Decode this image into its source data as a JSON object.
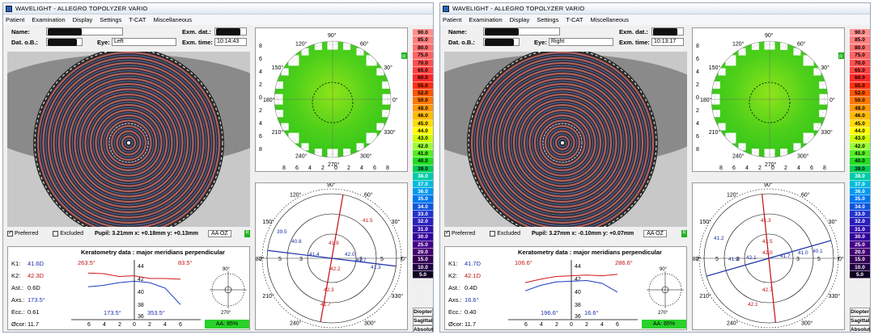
{
  "windows": [
    {
      "title": "WAVELIGHT  -  ALLEGRO TOPOLYZER VARIO",
      "menu": [
        "Patient",
        "Examination",
        "Display",
        "Settings",
        "T-CAT",
        "Miscellaneous"
      ],
      "patient": {
        "name_label": "Name:",
        "dob_label": "Dat. o.B.:",
        "eye_label": "Eye:",
        "eye_value": "Left",
        "exam_date_label": "Exm. dat.:",
        "exam_time_label": "Exm. time:",
        "exam_time_value": "10:14:43"
      },
      "eye_options": {
        "preferred": "Preferred",
        "excluded": "Excluded",
        "pupil": "Pupil: 3.21mm x: +0.18mm y: +0.13mm",
        "aa_button": "AA OZ",
        "tag": "R"
      },
      "keratometry": {
        "title": "Keratometry data : major meridians perpendicular",
        "k1_label": "K1:",
        "k1": "41.6D",
        "k2_label": "K2:",
        "k2": "42.3D",
        "ast_label": "Ast.:",
        "ast": "0.6D",
        "axs_label": "Axs.:",
        "axs": "173.5°",
        "ecc_label": "Ecc.:",
        "ecc": "0.61",
        "ocor_label": "Øcor:",
        "ocor": "11.7",
        "angle_left_top": "263.5°",
        "angle_right_top": "83.5°",
        "angle_left_bottom": "173.5°",
        "angle_right_bottom": "353.5°",
        "y_ticks": [
          "44",
          "42",
          "40",
          "38",
          "36"
        ],
        "x_ticks": [
          "6",
          "4",
          "2",
          "0",
          "2",
          "4",
          "6"
        ],
        "aa_status": "AA: 85%"
      },
      "keratometry_plot": {
        "x": [
          -6,
          -4,
          -2,
          0,
          2,
          4,
          6
        ],
        "red": [
          42.8,
          42.7,
          42.3,
          42.4,
          42.0,
          42.0,
          41.9
        ],
        "blue": [
          40.8,
          41.0,
          41.4,
          41.6,
          41.4,
          40.6,
          38.2
        ],
        "compass_top": "90°",
        "compass_bottom": "270°"
      },
      "axial_map": {
        "angles": [
          "90°",
          "60°",
          "30°",
          "0°",
          "330°",
          "300°",
          "270°",
          "240°",
          "210°",
          "180°",
          "150°",
          "120°"
        ],
        "y_ticks": [
          "8",
          "6",
          "4",
          "2",
          "0",
          "2",
          "4",
          "6",
          "8"
        ],
        "x_ticks": [
          "8",
          "6",
          "4",
          "2",
          "0",
          "2",
          "4",
          "6",
          "8"
        ],
        "tag": "R"
      },
      "meridian_map": {
        "angles": [
          "90°",
          "60°",
          "30°",
          "0°",
          "330°",
          "300°",
          "270°",
          "240°",
          "210°",
          "180°",
          "150°",
          "120°"
        ],
        "radius_labels": [
          "7",
          "5",
          "3",
          "3",
          "5",
          "7"
        ],
        "values": [
          "41.5",
          "41.9",
          "42.2",
          "42.3",
          "41.7",
          "39.5",
          "40.8",
          "41.4",
          "42.0",
          "41.7",
          "41.3"
        ]
      }
    },
    {
      "title": "WAVELIGHT  -  ALLEGRO TOPOLYZER VARIO",
      "menu": [
        "Patient",
        "Examination",
        "Display",
        "Settings",
        "T-CAT",
        "Miscellaneous"
      ],
      "patient": {
        "name_label": "Name:",
        "dob_label": "Dat. o.B.:",
        "eye_label": "Eye:",
        "eye_value": "Right",
        "exam_date_label": "Exm. dat.:",
        "exam_time_label": "Exm. time:",
        "exam_time_value": "10:13:17"
      },
      "eye_options": {
        "preferred": "Preferred",
        "excluded": "Excluded",
        "pupil": "Pupil: 3.27mm x: -0.10mm y: +0.07mm",
        "aa_button": "AA OZ",
        "tag": "R"
      },
      "keratometry": {
        "title": "Keratometry data : major meridians perpendicular",
        "k1_label": "K1:",
        "k1": "41.7D",
        "k2_label": "K2:",
        "k2": "42.1D",
        "ast_label": "Ast.:",
        "ast": "0.4D",
        "axs_label": "Axs.:",
        "axs": "16.6°",
        "ecc_label": "Ecc.:",
        "ecc": "0.40",
        "ocor_label": "Øcor:",
        "ocor": "11.7",
        "angle_left_top": "106.6°",
        "angle_right_top": "286.6°",
        "angle_left_bottom": "196.6°",
        "angle_right_bottom": "16.6°",
        "y_ticks": [
          "44",
          "42",
          "40",
          "38",
          "36"
        ],
        "x_ticks": [
          "6",
          "4",
          "2",
          "0",
          "2",
          "4",
          "6"
        ],
        "aa_status": "AA: 85%"
      },
      "keratometry_plot": {
        "x": [
          -6,
          -4,
          -2,
          0,
          2,
          4,
          6
        ],
        "red": [
          41.4,
          41.9,
          42.3,
          42.4,
          42.5,
          42.4,
          42.6
        ],
        "blue": [
          40.2,
          41.0,
          41.5,
          41.6,
          41.7,
          41.3,
          40.0
        ],
        "compass_top": "90°",
        "compass_bottom": "270°"
      },
      "axial_map": {
        "angles": [
          "90°",
          "60°",
          "30°",
          "0°",
          "330°",
          "300°",
          "270°",
          "240°",
          "210°",
          "180°",
          "150°",
          "120°"
        ],
        "y_ticks": [
          "8",
          "6",
          "4",
          "2",
          "0",
          "2",
          "4",
          "6",
          "8"
        ],
        "x_ticks": [
          "8",
          "6",
          "4",
          "2",
          "0",
          "2",
          "4",
          "6",
          "8"
        ],
        "tag": "R"
      },
      "meridian_map": {
        "angles": [
          "90°",
          "60°",
          "30°",
          "0°",
          "330°",
          "300°",
          "270°",
          "240°",
          "210°",
          "180°",
          "150°",
          "120°"
        ],
        "radius_labels": [
          "7",
          "5",
          "3",
          "3",
          "5",
          "7"
        ],
        "values": [
          "41.3",
          "41.5",
          "42.0",
          "42.7",
          "42.1",
          "41.2",
          "41.9",
          "42.1",
          "41.7",
          "41.0",
          "40.1"
        ]
      }
    }
  ],
  "scale": {
    "values": [
      "90.0",
      "85.0",
      "80.0",
      "75.0",
      "70.0",
      "65.0",
      "60.0",
      "55.0",
      "52.0",
      "50.0",
      "48.0",
      "46.0",
      "45.0",
      "44.0",
      "43.0",
      "42.0",
      "41.0",
      "40.0",
      "39.0",
      "38.0",
      "37.0",
      "36.0",
      "35.0",
      "34.0",
      "33.0",
      "32.0",
      "31.0",
      "30.0",
      "25.0",
      "20.0",
      "15.0",
      "10.0",
      "5.0"
    ],
    "colors": [
      "#ff9090",
      "#ff8080",
      "#ff7070",
      "#ff6464",
      "#ff5050",
      "#ff4040",
      "#ff2a2a",
      "#ff3010",
      "#ff5500",
      "#ff7700",
      "#ff9900",
      "#ffbb00",
      "#ffdd00",
      "#ffff00",
      "#ccff00",
      "#99ff33",
      "#55ee22",
      "#22dd22",
      "#00cc55",
      "#00ccaa",
      "#00bbdd",
      "#0099ee",
      "#0077ee",
      "#1155dd",
      "#2233cc",
      "#2a1fbb",
      "#3311aa",
      "#330099",
      "#440088",
      "#440070",
      "#330055",
      "#220044",
      "#110022"
    ],
    "footer": [
      "Diopter",
      "Sagittal",
      "Absolut"
    ]
  }
}
